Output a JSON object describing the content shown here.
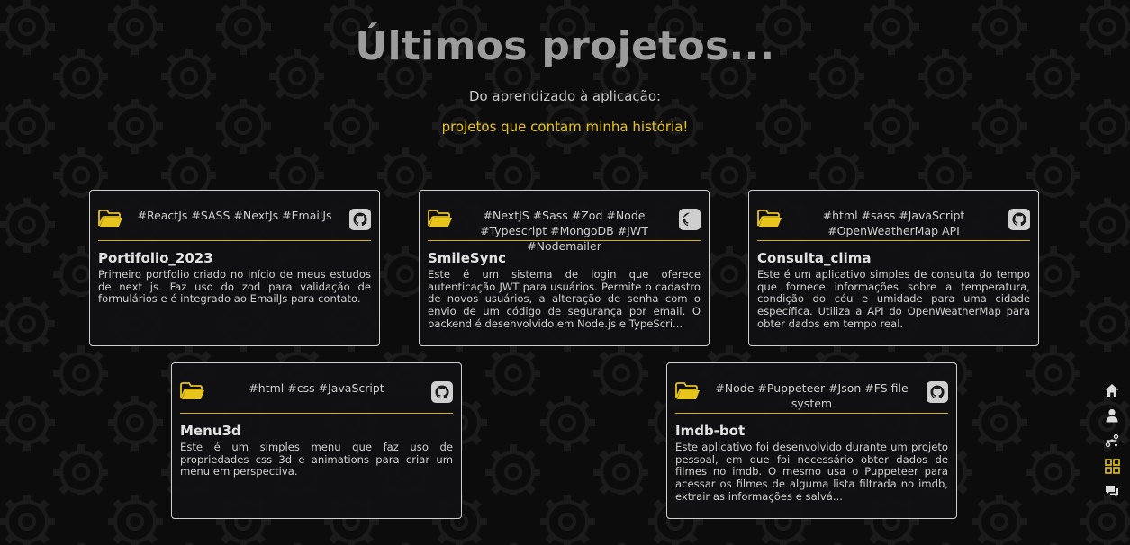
{
  "page": {
    "title": "Últimos projetos...",
    "subtitle": "Do aprendizado à aplicação:",
    "tagline": "projetos que contam minha história!"
  },
  "colors": {
    "accent": "#e8c51c",
    "background": "#0c0c0d",
    "card_border": "#cfcfcf",
    "title": "#9c9c9c"
  },
  "projects": [
    {
      "tags": "#ReactJs #SASS #NextJs #EmailJs",
      "name": "Portifolio_2023",
      "description": "Primeiro portfolio criado no início de meus estudos de next js. Faz uso do zod para validação de formulários e é integrado ao EmailJs para contato."
    },
    {
      "tags": "#NextJS #Sass #Zod #Node #Typescript #MongoDB #JWT #Nodemailer",
      "name": "SmileSync",
      "description": "Este é um sistema de login que oferece autenticação JWT para usuários. Permite o cadastro de novos usuários, a alteração de senha com o envio de um código de segurança por email. O backend é desenvolvido em Node.js e TypeScri..."
    },
    {
      "tags": "#html #sass #JavaScript #OpenWeatherMap API",
      "name": "Consulta_clima",
      "description": "Este é um aplicativo simples de consulta do tempo que fornece informações sobre a temperatura, condição do céu e umidade para uma cidade específica. Utiliza a API do OpenWeatherMap para obter dados em tempo real."
    },
    {
      "tags": "#html #css #JavaScript",
      "name": "Menu3d",
      "description": "Este é um simples menu que faz uso de propriedades css 3d e animations para criar um menu em perspectiva."
    },
    {
      "tags": "#Node #Puppeteer #Json #FS file system",
      "name": "Imdb-bot",
      "description": "Este aplicativo foi desenvolvido durante um projeto pessoal, em que foi necessário obter dados de filmes no imdb. O mesmo usa o Puppeteer para acessar os filmes de alguma lista filtrada no imdb, extrair as informações e salvá..."
    }
  ],
  "card_icons": {
    "folder": "folder-icon",
    "repo": "github-icon"
  },
  "side_nav": [
    {
      "icon": "home-icon"
    },
    {
      "icon": "user-icon"
    },
    {
      "icon": "skills-icon"
    },
    {
      "icon": "projects-grid-icon",
      "active": true
    },
    {
      "icon": "chat-icon"
    }
  ]
}
